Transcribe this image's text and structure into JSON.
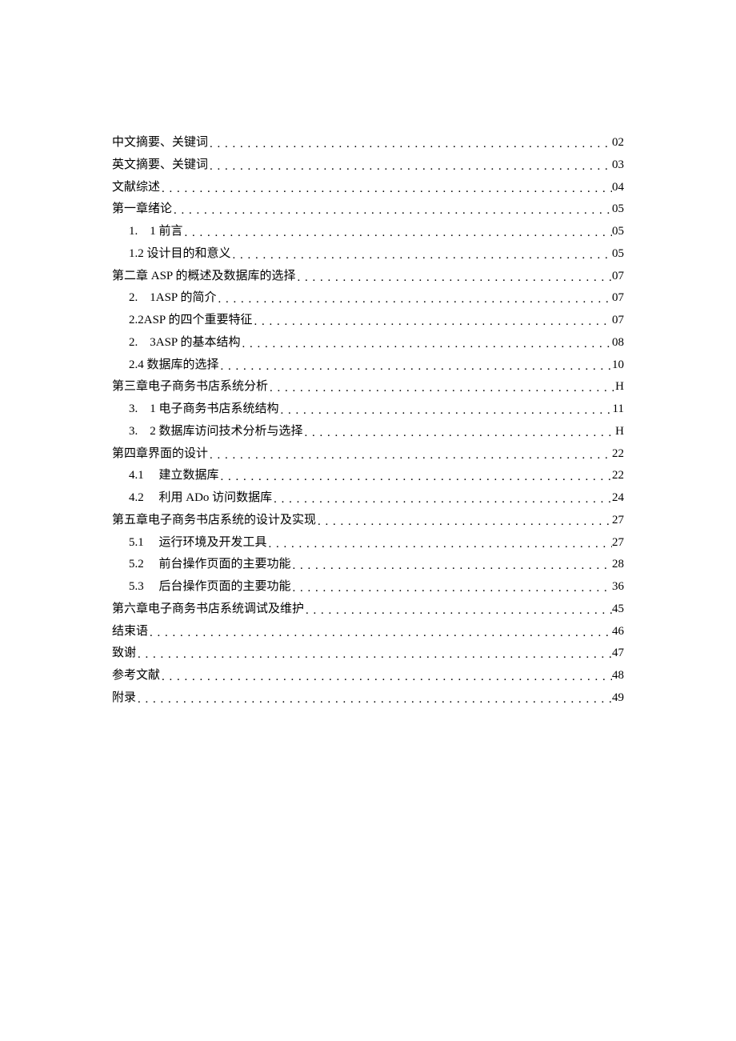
{
  "toc": [
    {
      "label": "中文摘要、关键词",
      "page": "02",
      "indent": 0
    },
    {
      "label": "英文摘要、关键词",
      "page": "03",
      "indent": 0
    },
    {
      "label": "文献综述",
      "page": "04",
      "indent": 0
    },
    {
      "label": "第一章绪论",
      "page": "05",
      "indent": 0
    },
    {
      "label": "1.　1 前言",
      "page": "05",
      "indent": 1
    },
    {
      "label": "1.2 设计目的和意义",
      "page": "05",
      "indent": 1
    },
    {
      "label": "第二章 ASP 的概述及数据库的选择",
      "page": "07",
      "indent": 0
    },
    {
      "label": "2.　1ASP 的简介",
      "page": "07",
      "indent": 1
    },
    {
      "label": "2.2ASP 的四个重要特征",
      "page": "07",
      "indent": 1
    },
    {
      "label": "2.　3ASP 的基本结构",
      "page": "08",
      "indent": 1
    },
    {
      "label": "2.4 数据库的选择",
      "page": "10",
      "indent": 1
    },
    {
      "label": "第三章电子商务书店系统分析",
      "page": "H",
      "indent": 0
    },
    {
      "label": "3.　1 电子商务书店系统结构",
      "page": "11",
      "indent": 1
    },
    {
      "label": "3.　2 数据库访问技术分析与选择",
      "page": "H",
      "indent": 1
    },
    {
      "label": "第四章界面的设计",
      "page": "22",
      "indent": 0
    },
    {
      "label": "4.1　 建立数据库",
      "page": "22",
      "indent": 1
    },
    {
      "label": "4.2　 利用 ADo 访问数据库",
      "page": "24",
      "indent": 1
    },
    {
      "label": "第五章电子商务书店系统的设计及实现",
      "page": "27",
      "indent": 0
    },
    {
      "label": "5.1　 运行环境及开发工具",
      "page": "27",
      "indent": 1
    },
    {
      "label": "5.2　 前台操作页面的主要功能",
      "page": "28",
      "indent": 1
    },
    {
      "label": "5.3　 后台操作页面的主要功能",
      "page": "36",
      "indent": 1
    },
    {
      "label": "第六章电子商务书店系统调试及维护",
      "page": "45",
      "indent": 0
    },
    {
      "label": "结束语",
      "page": "46",
      "indent": 0
    },
    {
      "label": "致谢",
      "page": "47",
      "indent": 0
    },
    {
      "label": "参考文献",
      "page": "48",
      "indent": 0
    },
    {
      "label": "附录",
      "page": "49",
      "indent": 0
    }
  ]
}
